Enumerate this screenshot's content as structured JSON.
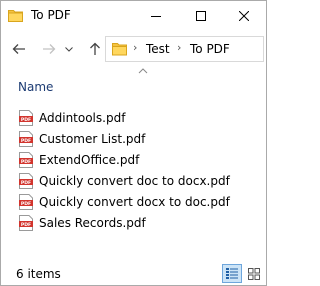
{
  "window": {
    "title": "To PDF"
  },
  "address": {
    "crumbs": [
      "Test",
      "To PDF"
    ]
  },
  "list": {
    "column_header": "Name",
    "sort": "ascending",
    "files": [
      "Addintools.pdf",
      "Customer List.pdf",
      "ExtendOffice.pdf",
      "Quickly convert doc to docx.pdf",
      "Quickly convert docx to doc.pdf",
      "Sales Records.pdf"
    ]
  },
  "status": {
    "item_count": "6 items",
    "active_view": "details"
  },
  "colors": {
    "folder": "#f5c342",
    "pdf_icon": "#d2342d",
    "header_text": "#1c3b73",
    "selected_view_bg": "#cce4f7"
  }
}
